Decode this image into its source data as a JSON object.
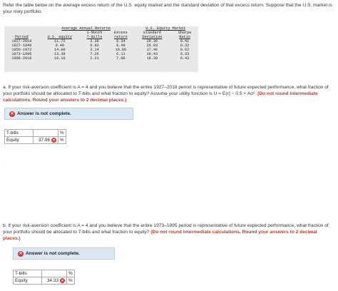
{
  "intro": "Refer the table below on the average excess return of the U.S. equity market and the standard deviation of that excess return. Suppose that the U.S. market is your risky portfolio.",
  "table": {
    "group1": "Average Annual Returns",
    "group2": "U.S. Equity Market",
    "headers": [
      [
        "Period",
        ""
      ],
      [
        "U.S. equity",
        ""
      ],
      [
        "1-Month",
        "T-Bills"
      ],
      [
        "Excess",
        "return"
      ],
      [
        "Standard",
        "Deviation"
      ],
      [
        "Sharpe",
        "Ratio"
      ]
    ],
    "rows": [
      [
        "1927-2018",
        "11.72",
        "3.38",
        "8.34",
        "20.36",
        "0.41"
      ],
      [
        "1927-1949",
        "9.40",
        "0.92",
        "8.49",
        "26.83",
        "0.32"
      ],
      [
        "1950-1972",
        "14.00",
        "3.14",
        "10.86",
        "17.46",
        "0.62"
      ],
      [
        "1973-1995",
        "13.38",
        "7.26",
        "6.11",
        "18.43",
        "0.33"
      ],
      [
        "1996-2018",
        "10.10",
        "2.21",
        "7.88",
        "18.39",
        "0.43"
      ]
    ]
  },
  "qa": {
    "text1": "a. If your risk-aversion coefficient is A = 4 and you believe that the entire 1927–2018 period is representative of future expected performance, what fraction of your portfolio should be allocated to T-bills and what fraction to equity? Assume your utility function is U = E(r) − 0.5 × Aσ².",
    "bold": "(Do not round intermediate calculations. Round your answers to 2 decimal places.)",
    "banner": "Answer is not complete.",
    "rows": [
      {
        "label": "T-bills",
        "value": "",
        "unit": "%"
      },
      {
        "label": "Equity",
        "value": "37.96",
        "unit": "%"
      }
    ]
  },
  "qb": {
    "text1": "b. If your risk-aversion coefficient is A = 4 and you believe that the entire 1973–1995 period is representative of future expected performance, what fraction of your portfolio should be allocated to T-bills and what fraction to equity?",
    "bold": "(Do not round intermediate calculations. Round your answers to 2 decimal places.)",
    "banner": "Answer is not complete.",
    "rows": [
      {
        "label": "T-bills",
        "value": "",
        "unit": "%"
      },
      {
        "label": "Equity",
        "value": "34.33",
        "unit": "%"
      }
    ]
  },
  "colors": {
    "error": "#d9342b",
    "banner_bg": "#dbe8f5"
  }
}
